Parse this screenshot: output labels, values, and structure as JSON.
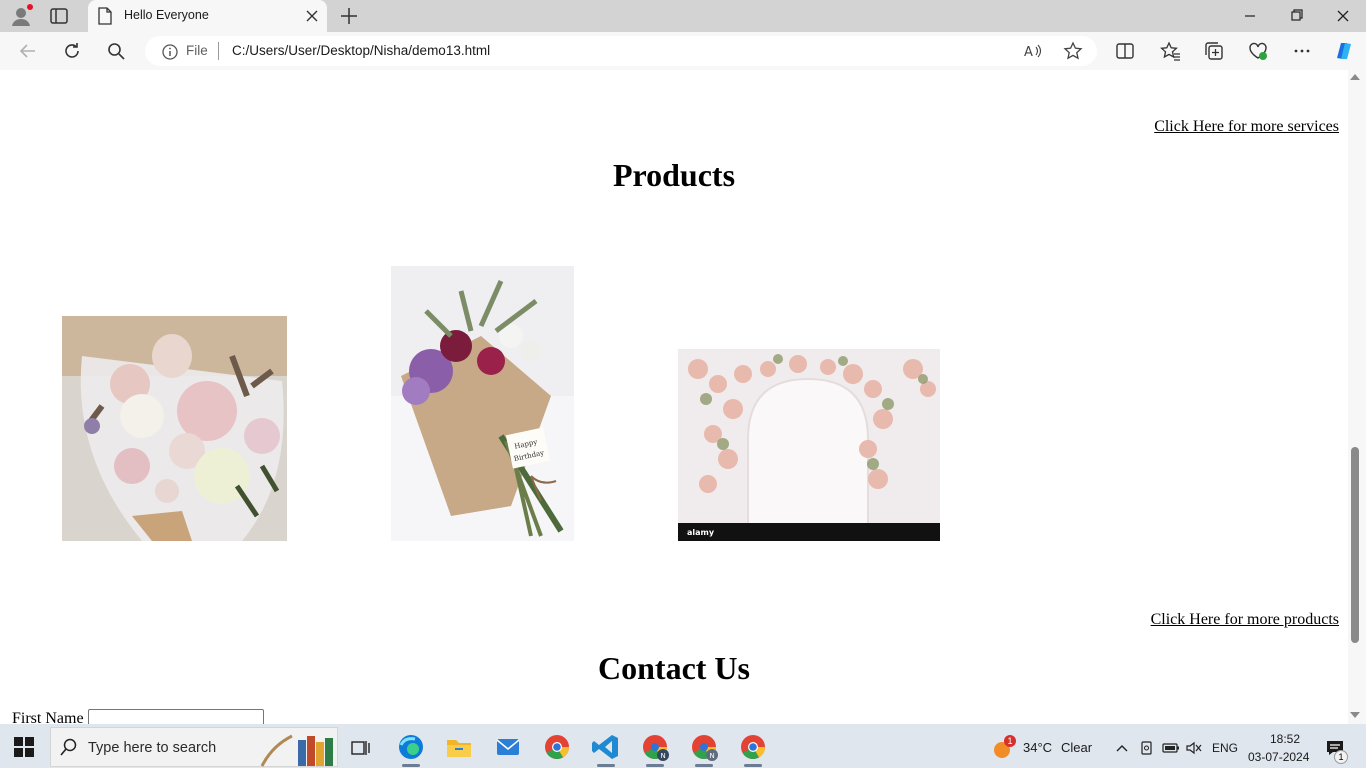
{
  "browser": {
    "tab_title": "Hello Everyone",
    "address_scheme_label": "File",
    "address_url": "C:/Users/User/Desktop/Nisha/demo13.html"
  },
  "page": {
    "services_link": "Click Here for more services",
    "products_heading": "Products",
    "products_link": "Click Here for more products",
    "contact_heading": "Contact Us",
    "first_name_label": "First Name",
    "first_name_value": "",
    "product_images": [
      {
        "name": "white-pink-bouquet-image"
      },
      {
        "name": "happy-birthday-bouquet-image",
        "card_text": "Happy Birthday"
      },
      {
        "name": "floral-arch-image",
        "watermark": "alamy"
      }
    ]
  },
  "taskbar": {
    "search_placeholder": "Type here to search",
    "weather_temp": "34°C",
    "weather_desc": "Clear",
    "weather_badge": "1",
    "language": "ENG",
    "time": "18:52",
    "date": "03-07-2024",
    "notification_count": "1"
  },
  "colors": {
    "titlebar": "#d3d3d3",
    "toolbar": "#f7f7f7",
    "taskbar": "#dfe6ee",
    "edge_accent": "#0f7bd8"
  }
}
